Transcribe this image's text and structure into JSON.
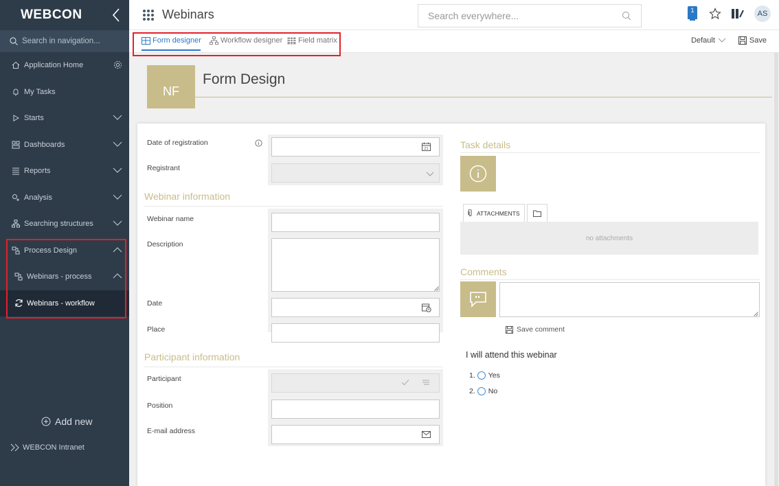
{
  "sidebar": {
    "logo": "WEBCON",
    "search_placeholder": "Search in navigation...",
    "items": [
      {
        "label": "Application Home"
      },
      {
        "label": "My Tasks"
      },
      {
        "label": "Starts"
      },
      {
        "label": "Dashboards"
      },
      {
        "label": "Reports"
      },
      {
        "label": "Analysis"
      },
      {
        "label": "Searching structures"
      },
      {
        "label": "Process Design"
      },
      {
        "label": "Webinars - process"
      },
      {
        "label": "Webinars - workflow"
      }
    ],
    "add_new": "Add new",
    "intranet": "WEBCON Intranet"
  },
  "header": {
    "app_title": "Webinars",
    "search_placeholder": "Search everywhere...",
    "task_badge": "1",
    "avatar": "AS"
  },
  "designer": {
    "tabs": [
      "Form designer",
      "Workflow designer",
      "Field matrix"
    ],
    "default_label": "Default",
    "save_label": "Save"
  },
  "form": {
    "badge": "NF",
    "title": "Form Design",
    "fields": {
      "date_registration": "Date of registration",
      "registrant": "Registrant",
      "webinar_name": "Webinar name",
      "description": "Description",
      "date": "Date",
      "place": "Place",
      "participant": "Participant",
      "position": "Position",
      "email": "E-mail address"
    },
    "sections": {
      "webinar_info": "Webinar information",
      "participant_info": "Participant information",
      "task_details": "Task details",
      "comments": "Comments"
    },
    "attachments_tab": "ATTACHMENTS",
    "no_attachments": "no attachments",
    "save_comment": "Save comment",
    "attend_question": "I will attend this webinar",
    "options": [
      "1.",
      "Yes",
      "2.",
      "No"
    ]
  }
}
